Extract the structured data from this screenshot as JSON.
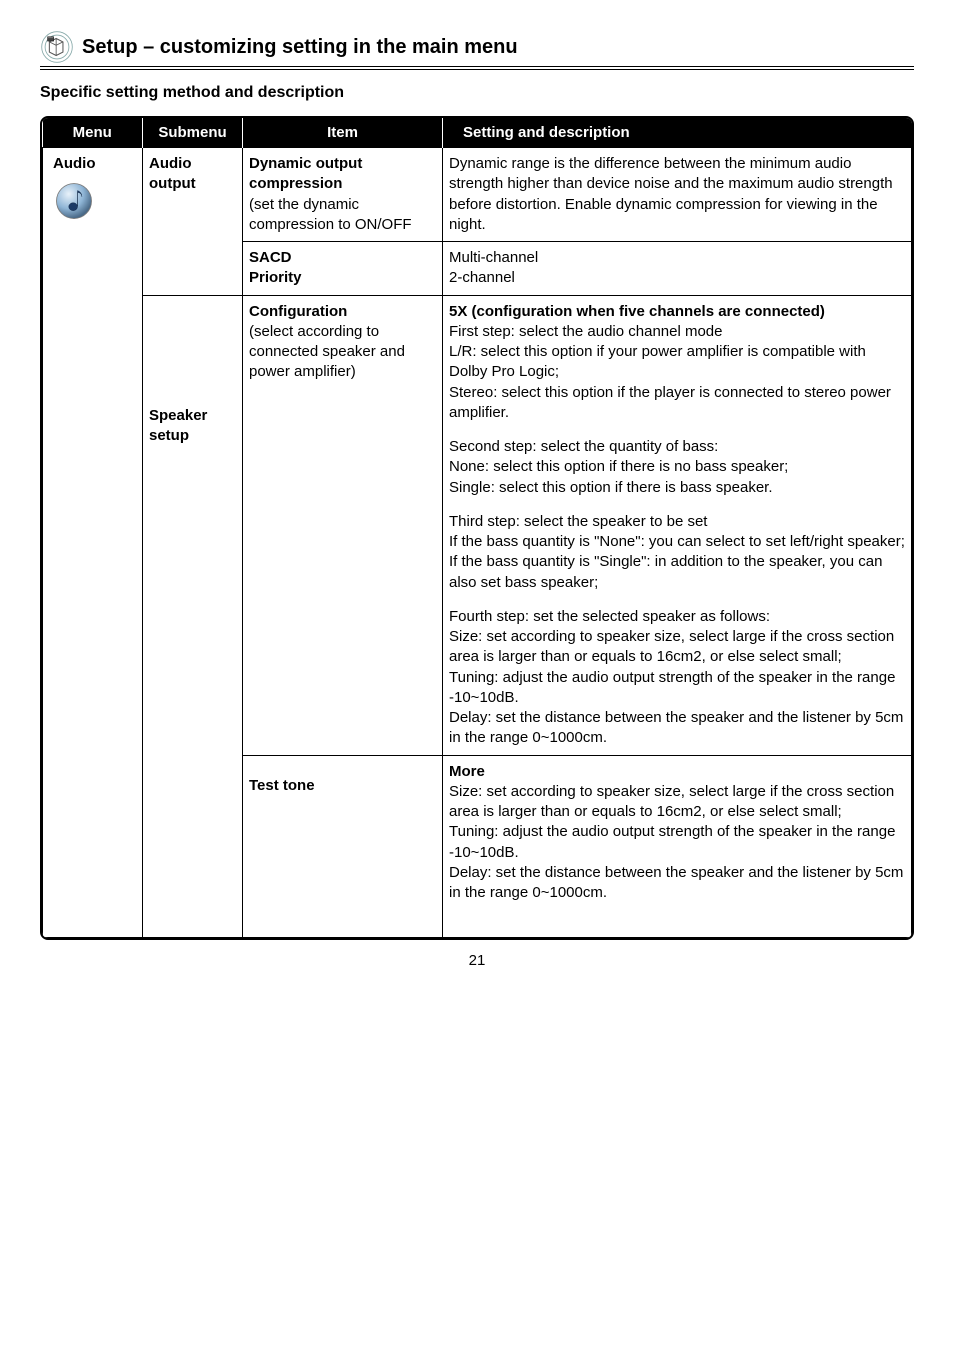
{
  "header": {
    "title": "Setup – customizing setting in the main menu"
  },
  "subtitle": "Specific setting method and description",
  "columns": {
    "menu": "Menu",
    "submenu": "Submenu",
    "item": "Item",
    "desc": "Setting and description"
  },
  "menuLabel": "Audio",
  "rows": {
    "r1": {
      "submenu": "Audio output",
      "itemTitle": "Dynamic output compression",
      "itemDetail": "(set the dynamic compression to ON/OFF",
      "desc": "Dynamic range is the difference between the minimum audio strength higher than device noise and the maximum audio strength before distortion. Enable dynamic compression for viewing in the night."
    },
    "r2": {
      "itemTitle": "SACD\nPriority",
      "descLine1": "Multi-channel",
      "descLine2": "2-channel"
    },
    "r3": {
      "submenu": "Speaker setup",
      "itemTitle": "Configuration",
      "itemDetail": "(select according to connected speaker and power amplifier)",
      "p1Title": "5X (configuration when five channels are connected)",
      "p1Body": "First step: select the audio channel mode\nL/R: select this option if your power amplifier is compatible with Dolby Pro Logic;\nStereo: select this option if the player is connected to stereo power amplifier.",
      "p2": "Second step: select the quantity of bass:\nNone: select this option if there is no bass speaker;\nSingle: select this option if there is bass speaker.",
      "p3": "Third step: select the speaker to be set\nIf the bass quantity is \"None\": you can select to set left/right speaker;\nIf the bass quantity is \"Single\": in addition to the speaker, you can also set bass speaker;",
      "p4": "Fourth step: set the selected speaker as follows:\nSize: set according to speaker size, select large if the cross section area is larger than or equals to 16cm2, or else select small;\nTuning: adjust the audio output strength of the speaker in the range -10~10dB.\nDelay: set the distance between the speaker and the listener by 5cm in the range 0~1000cm."
    },
    "r4": {
      "itemTitle": "Test tone",
      "descTitle": "More",
      "descBody": "Size: set according to speaker size, select large if the cross section area is larger than or equals to 16cm2, or else select small;\nTuning: adjust the audio output strength of the speaker in the range -10~10dB.\nDelay: set the distance between the speaker and the listener by 5cm in the range 0~1000cm."
    }
  },
  "pageNumber": "21"
}
